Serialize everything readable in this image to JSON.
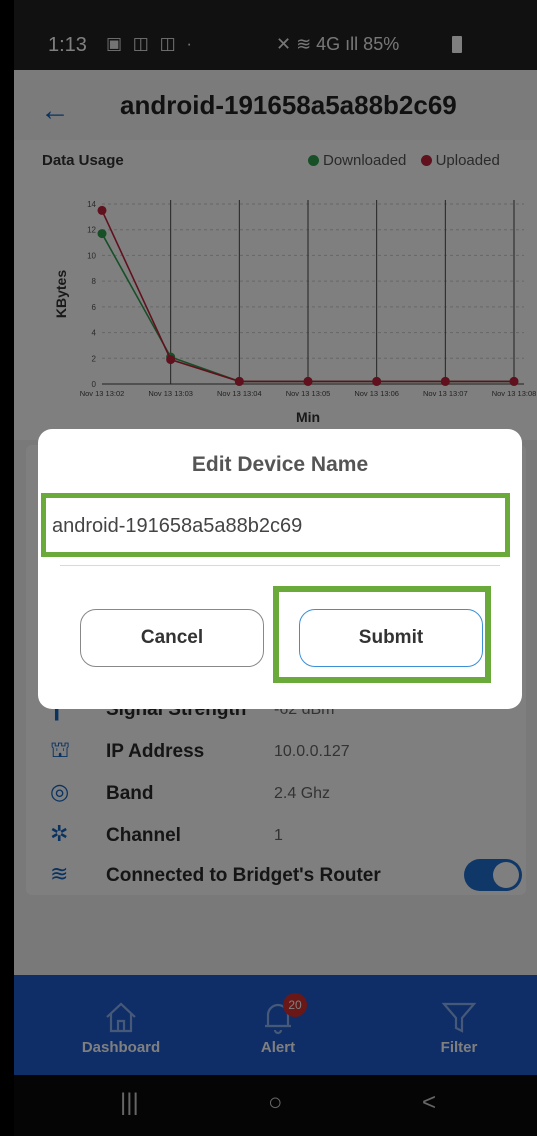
{
  "status_bar": {
    "time": "1:13",
    "left_icons": "▣ ◫ ◫ ·",
    "right_text": "✕ ≋ 4G ıll 85%"
  },
  "header": {
    "title": "android-191658a5a88b2c69"
  },
  "chart_section": {
    "title": "Data Usage",
    "legend_downloaded": "Downloaded",
    "legend_uploaded": "Uploaded"
  },
  "chart_data": {
    "type": "line",
    "title": "Data Usage",
    "xlabel": "Min",
    "ylabel": "KBytes",
    "ylim": [
      0,
      14
    ],
    "yticks": [
      "0",
      "2",
      "4",
      "6",
      "8",
      "10",
      "12",
      "14"
    ],
    "categories": [
      "Nov 13 13:02",
      "Nov 13 13:03",
      "Nov 13 13:04",
      "Nov 13 13:05",
      "Nov 13 13:06",
      "Nov 13 13:07",
      "Nov 13 13:08"
    ],
    "series": [
      {
        "name": "Downloaded",
        "color": "#2e9e4f",
        "values": [
          11.7,
          2.1,
          0.2,
          0.2,
          0.2,
          0.2,
          0.2
        ]
      },
      {
        "name": "Uploaded",
        "color": "#c0233b",
        "values": [
          13.5,
          1.9,
          0.2,
          0.2,
          0.2,
          0.2,
          0.2
        ]
      }
    ],
    "grid": true,
    "legend_position": "top-right"
  },
  "device_info": {
    "rows": [
      {
        "icon": "signal-strength-icon",
        "label": "Signal Strength",
        "value": "-62 dBm"
      },
      {
        "icon": "ip-address-icon",
        "label": "IP Address",
        "value": "10.0.0.127"
      },
      {
        "icon": "band-icon",
        "label": "Band",
        "value": "2.4 Ghz"
      },
      {
        "icon": "channel-icon",
        "label": "Channel",
        "value": "1"
      },
      {
        "icon": "wifi-icon",
        "label": "Connected to Bridget's Router",
        "value": ""
      }
    ],
    "connected_toggle": "on"
  },
  "dialog": {
    "title": "Edit Device Name",
    "input_value": "android-191658a5a88b2c69",
    "cancel_label": "Cancel",
    "submit_label": "Submit"
  },
  "bottom_nav": {
    "dashboard_label": "Dashboard",
    "alert_label": "Alert",
    "alert_count": "20",
    "filter_label": "Filter"
  },
  "system_nav": {
    "recents": "|||",
    "home": "○",
    "back": "<"
  },
  "colors": {
    "accent": "#1f5dcf",
    "highlight": "#6aaa3a",
    "downloaded": "#2e9e4f",
    "uploaded": "#c0233b"
  }
}
